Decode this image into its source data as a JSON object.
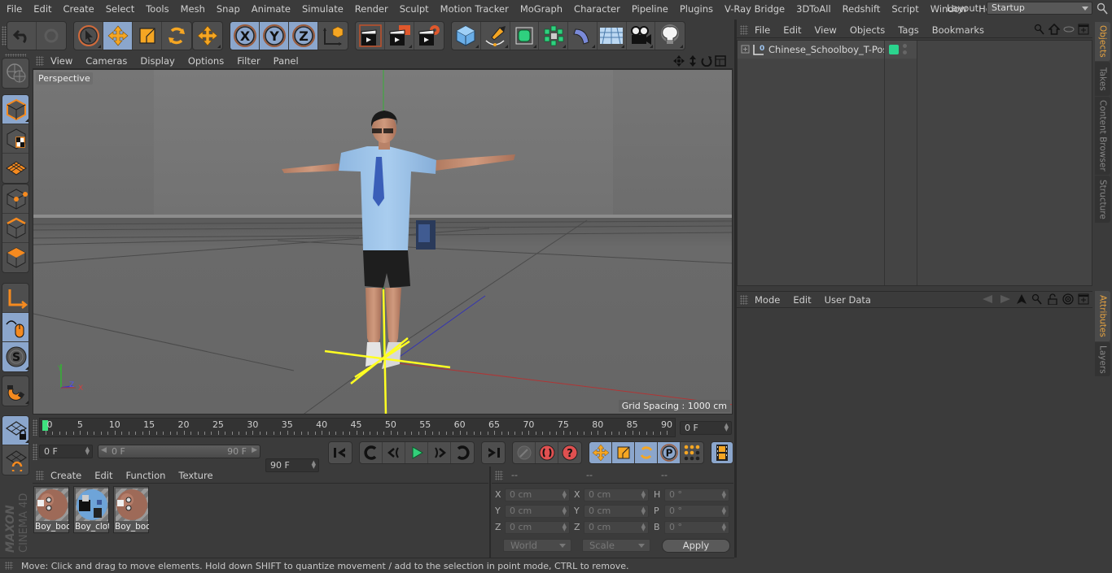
{
  "menubar": {
    "items": [
      "File",
      "Edit",
      "Create",
      "Select",
      "Tools",
      "Mesh",
      "Snap",
      "Animate",
      "Simulate",
      "Render",
      "Sculpt",
      "Motion Tracker",
      "MoGraph",
      "Character",
      "Pipeline",
      "Plugins",
      "V-Ray Bridge",
      "3DToAll",
      "Redshift",
      "Script",
      "Window",
      "Help"
    ],
    "layout_label": "Layout:",
    "layout_value": "Startup"
  },
  "toolbar": {
    "groups": [
      {
        "name": "history",
        "buttons": [
          {
            "icon": "undo-icon",
            "active": false
          },
          {
            "icon": "redo-icon",
            "active": false,
            "disabled": true
          }
        ]
      },
      {
        "name": "tools",
        "buttons": [
          {
            "icon": "live-selection-icon",
            "active": false
          },
          {
            "icon": "move-icon",
            "active": true
          },
          {
            "icon": "scale-icon",
            "active": false
          },
          {
            "icon": "rotate-icon",
            "active": false
          }
        ]
      },
      {
        "name": "recent",
        "buttons": [
          {
            "icon": "recent-tool-move-icon",
            "active": false
          }
        ]
      },
      {
        "name": "axes",
        "buttons": [
          {
            "icon": "x-axis-lock-icon",
            "label": "X",
            "active": true
          },
          {
            "icon": "y-axis-lock-icon",
            "label": "Y",
            "active": true
          },
          {
            "icon": "z-axis-lock-icon",
            "label": "Z",
            "active": true
          },
          {
            "icon": "coordinate-system-icon",
            "active": false
          }
        ]
      },
      {
        "name": "render",
        "buttons": [
          {
            "icon": "render-view-icon"
          },
          {
            "icon": "render-to-picture-viewer-icon"
          },
          {
            "icon": "render-settings-icon"
          }
        ]
      },
      {
        "name": "create",
        "buttons": [
          {
            "icon": "cube-primitive-icon"
          },
          {
            "icon": "pen-spline-icon"
          },
          {
            "icon": "subdivision-surface-icon"
          },
          {
            "icon": "cloner-icon"
          },
          {
            "icon": "bend-deformer-icon"
          },
          {
            "icon": "floor-icon"
          },
          {
            "icon": "camera-icon"
          },
          {
            "icon": "light-icon"
          }
        ]
      }
    ]
  },
  "left_tools": [
    {
      "icon": "make-editable-icon",
      "active": false
    },
    {
      "icon": "model-mode-icon",
      "active": true
    },
    {
      "icon": "texture-mode-icon",
      "active": false
    },
    {
      "icon": "workplane-mode-icon",
      "active": false
    },
    {
      "icon": "points-mode-icon",
      "active": false
    },
    {
      "icon": "edges-mode-icon",
      "active": false
    },
    {
      "icon": "polygons-mode-icon",
      "active": false
    },
    {
      "icon": "axis-mode-icon",
      "active": false
    },
    {
      "icon": "tweak-mode-icon",
      "active": true
    },
    {
      "icon": "solo-icon",
      "active": true
    },
    {
      "icon": "snap-magnet-icon",
      "active": false
    },
    {
      "icon": "lock-workplane-icon",
      "active": true
    },
    {
      "icon": "planar-workplane-icon",
      "active": false
    }
  ],
  "branding": {
    "line1": "MAXON",
    "line2": "CINEMA 4D"
  },
  "viewport": {
    "menu": [
      "View",
      "Cameras",
      "Display",
      "Options",
      "Filter",
      "Panel"
    ],
    "camera_label": "Perspective",
    "grid_spacing": "Grid Spacing : 1000 cm",
    "axis_labels": {
      "y": "Y",
      "z": "Z",
      "x": "X"
    },
    "nav_icons": [
      "pan-icon",
      "dolly-icon",
      "orbit-icon",
      "maximize-view-icon"
    ],
    "colors": {
      "sky": "#7a7a7a",
      "floor": "#686868",
      "y_axis": "#35b035",
      "x_axis": "#b03535",
      "z_axis": "#3535b0",
      "gizmo": "#ffff22"
    }
  },
  "timeline": {
    "ticks": [
      0,
      5,
      10,
      15,
      20,
      25,
      30,
      35,
      40,
      45,
      50,
      55,
      60,
      65,
      70,
      75,
      80,
      85,
      90
    ],
    "current_frame": 0,
    "current_frame_field": "0 F",
    "min_frame": 0,
    "max_frame": 90
  },
  "transport": {
    "start_field": "0 F",
    "range_start": "0 F",
    "range_end": "90 F",
    "end_field": "90 F",
    "buttons": [
      "go-to-start-icon",
      "previous-key-icon",
      "previous-frame-icon",
      "play-icon",
      "next-frame-icon",
      "next-key-icon",
      "go-to-end-icon"
    ],
    "key_buttons": [
      "motion-path-icon",
      "record-active-icon",
      "autokey-icon"
    ],
    "key_filters": [
      "key-position-icon",
      "key-scale-icon",
      "key-rotation-icon",
      "key-parameter-icon",
      "key-point-level-icon"
    ],
    "timeline_window_icon": "film-strip-icon"
  },
  "materials": {
    "menu": [
      "Create",
      "Edit",
      "Function",
      "Texture"
    ],
    "items": [
      {
        "name": "Boy_boc",
        "type": "skin"
      },
      {
        "name": "Boy_clot",
        "type": "cloth"
      },
      {
        "name": "Boy_boc",
        "type": "skin"
      }
    ]
  },
  "coordinates": {
    "headers": [
      "--",
      "--",
      "--"
    ],
    "rows": [
      {
        "l1": "X",
        "v1": "0 cm",
        "l2": "X",
        "v2": "0 cm",
        "l3": "H",
        "v3": "0 °"
      },
      {
        "l1": "Y",
        "v1": "0 cm",
        "l2": "Y",
        "v2": "0 cm",
        "l3": "P",
        "v3": "0 °"
      },
      {
        "l1": "Z",
        "v1": "0 cm",
        "l2": "Z",
        "v2": "0 cm",
        "l3": "B",
        "v3": "0 °"
      }
    ],
    "mode_select": "World",
    "size_select": "Scale",
    "apply_label": "Apply"
  },
  "status": {
    "text": "Move: Click and drag to move elements. Hold down SHIFT to quantize movement / add to the selection in point mode, CTRL to remove."
  },
  "object_manager": {
    "menu": [
      "File",
      "Edit",
      "View",
      "Objects",
      "Tags",
      "Bookmarks"
    ],
    "objects": [
      {
        "name": "Chinese_Schoolboy_T-Pose",
        "layer_color": "#2bd48e"
      }
    ]
  },
  "attribute_manager": {
    "menu": [
      "Mode",
      "Edit",
      "User Data"
    ]
  },
  "side_tabs_top": [
    {
      "label": "Objects",
      "active": true
    },
    {
      "label": "Takes",
      "active": false
    },
    {
      "label": "Content Browser",
      "active": false
    },
    {
      "label": "Structure",
      "active": false
    }
  ],
  "side_tabs_bottom": [
    {
      "label": "Attributes",
      "active": true
    },
    {
      "label": "Layers",
      "active": false
    }
  ]
}
